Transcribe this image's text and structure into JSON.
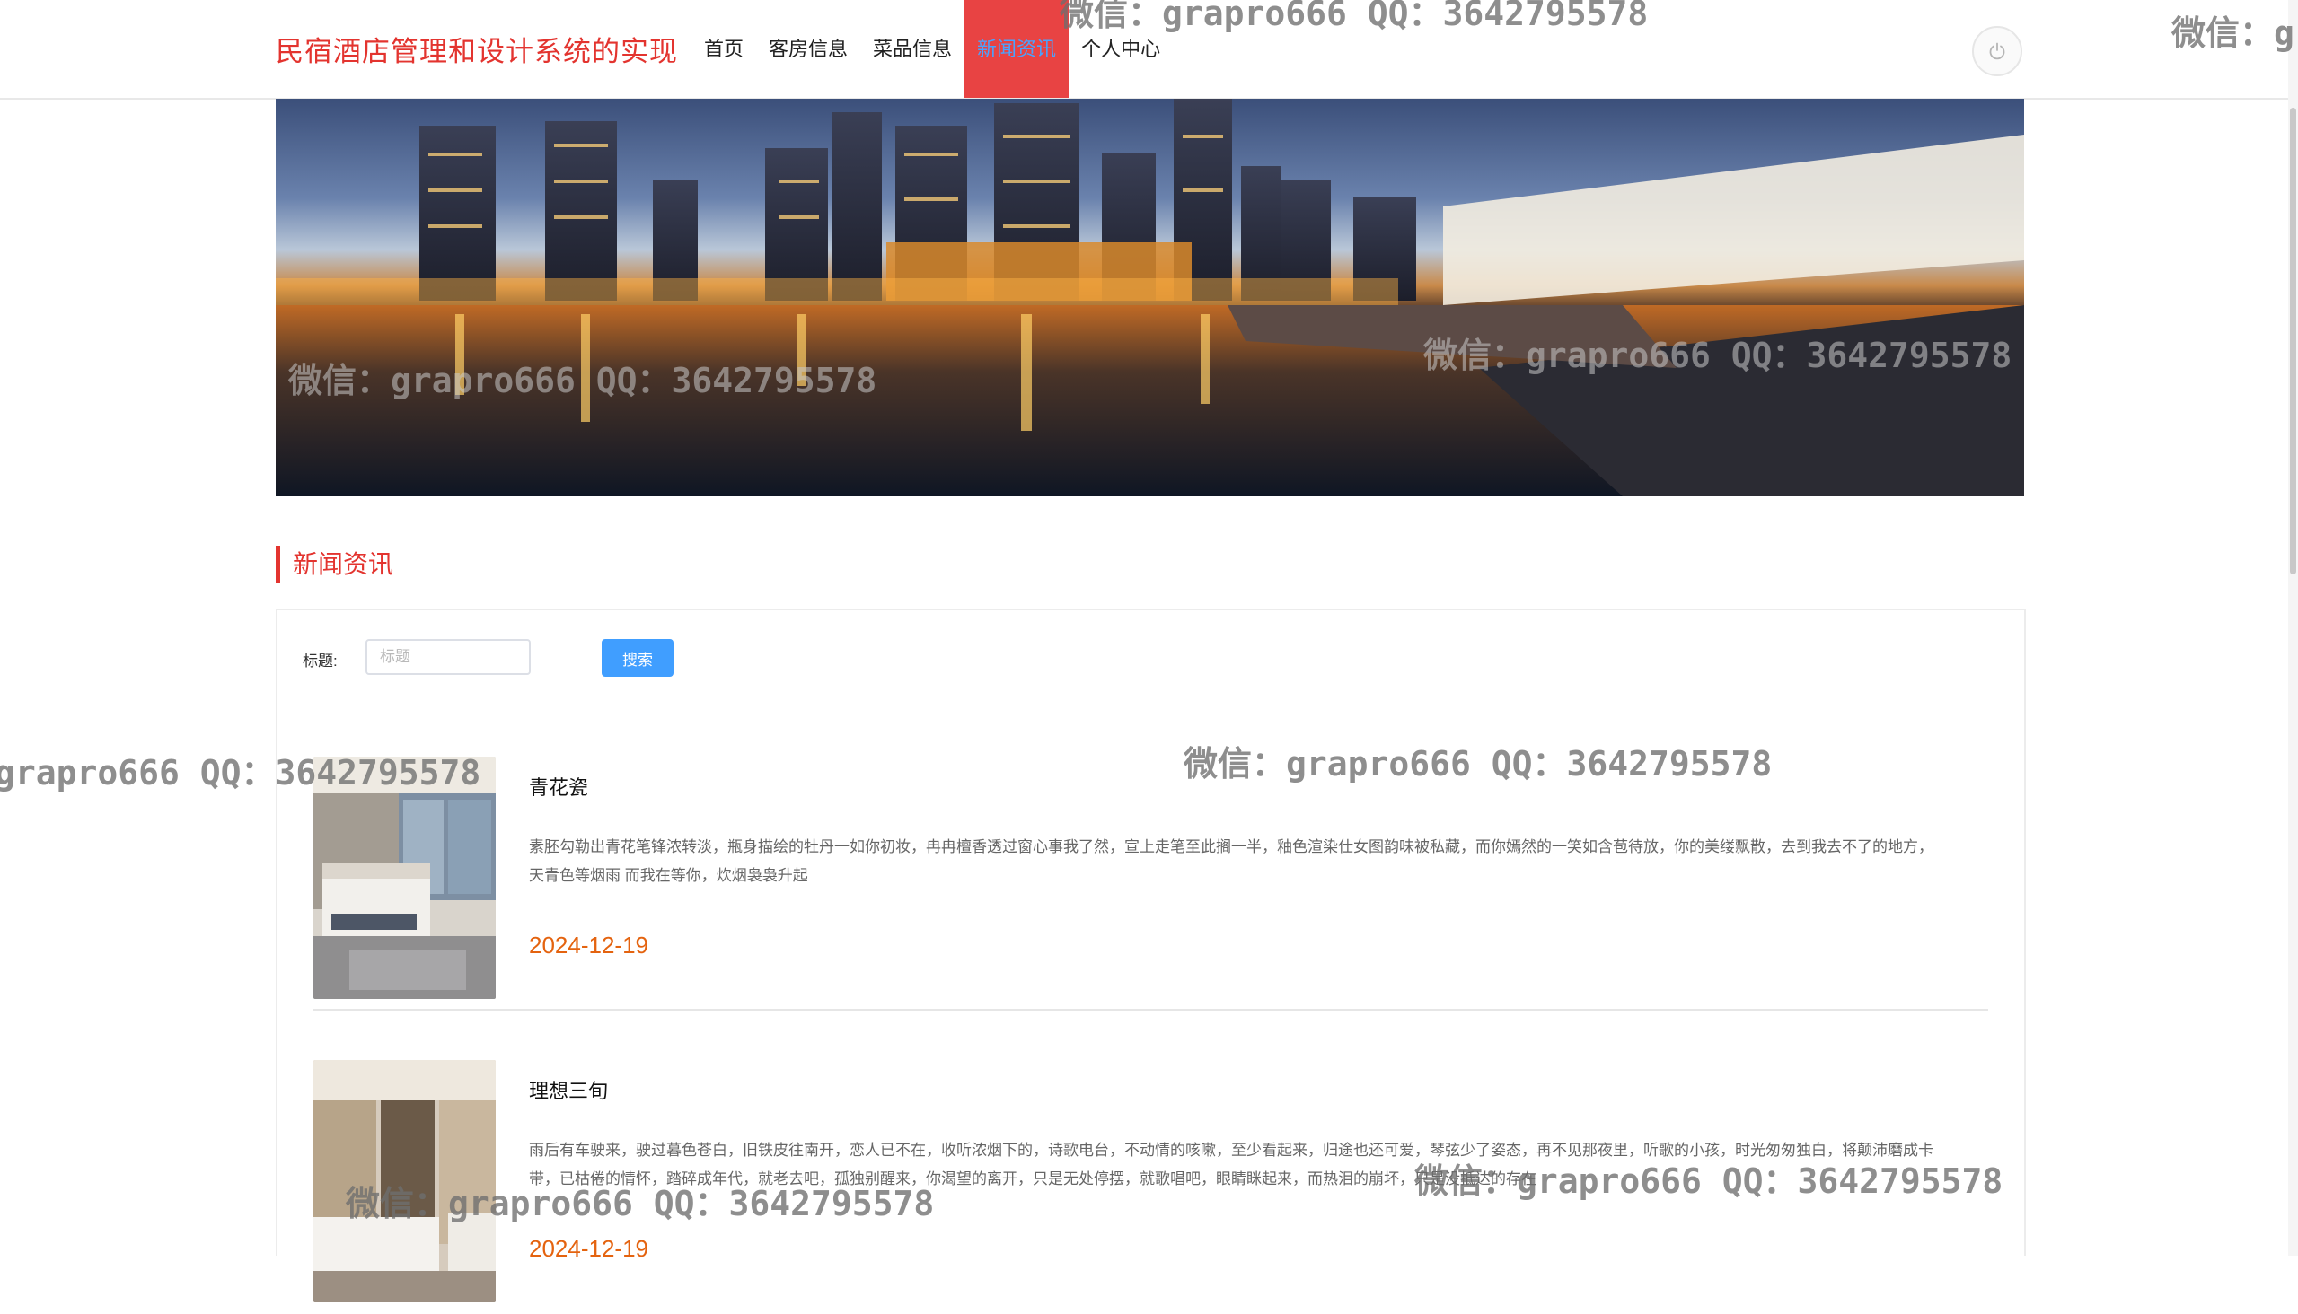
{
  "header": {
    "site_title": "民宿酒店管理和设计系统的实现",
    "nav": [
      {
        "label": "首页",
        "active": false
      },
      {
        "label": "客房信息",
        "active": false
      },
      {
        "label": "菜品信息",
        "active": false
      },
      {
        "label": "新闻资讯",
        "active": true
      },
      {
        "label": "个人中心",
        "active": false
      }
    ],
    "logout_icon": "power-icon"
  },
  "section": {
    "title": "新闻资讯"
  },
  "search": {
    "label": "标题:",
    "placeholder": "标题",
    "value": "",
    "button_label": "搜索"
  },
  "news": [
    {
      "title": "青花瓷",
      "desc": "素胚勾勒出青花笔锋浓转淡，瓶身描绘的牡丹一如你初妆，冉冉檀香透过窗心事我了然，宣上走笔至此搁一半，釉色渲染仕女图韵味被私藏，而你嫣然的一笑如含苞待放，你的美缕飘散，去到我去不了的地方，天青色等烟雨 而我在等你，炊烟袅袅升起",
      "date": "2024-12-19"
    },
    {
      "title": "理想三旬",
      "desc": "雨后有车驶来，驶过暮色苍白，旧铁皮往南开，恋人已不在，收听浓烟下的，诗歌电台，不动情的咳嗽，至少看起来，归途也还可爱，琴弦少了姿态，再不见那夜里，听歌的小孩，时光匆匆独白，将颠沛磨成卡带，已枯倦的情怀，踏碎成年代，就老去吧，孤独别醒来，你渴望的离开，只是无处停摆，就歌唱吧，眼睛眯起来，而热泪的崩坏，只是没抵达的存在",
      "date": "2024-12-19"
    }
  ],
  "watermark_text": "微信：grapro666 QQ：3642795578",
  "watermark_fragment": "微信：g",
  "colors": {
    "brand_red": "#e3342f",
    "nav_active_bg": "#e84343",
    "nav_active_text": "#4aa3ff",
    "search_button": "#409eff",
    "date_orange": "#e4630f"
  }
}
